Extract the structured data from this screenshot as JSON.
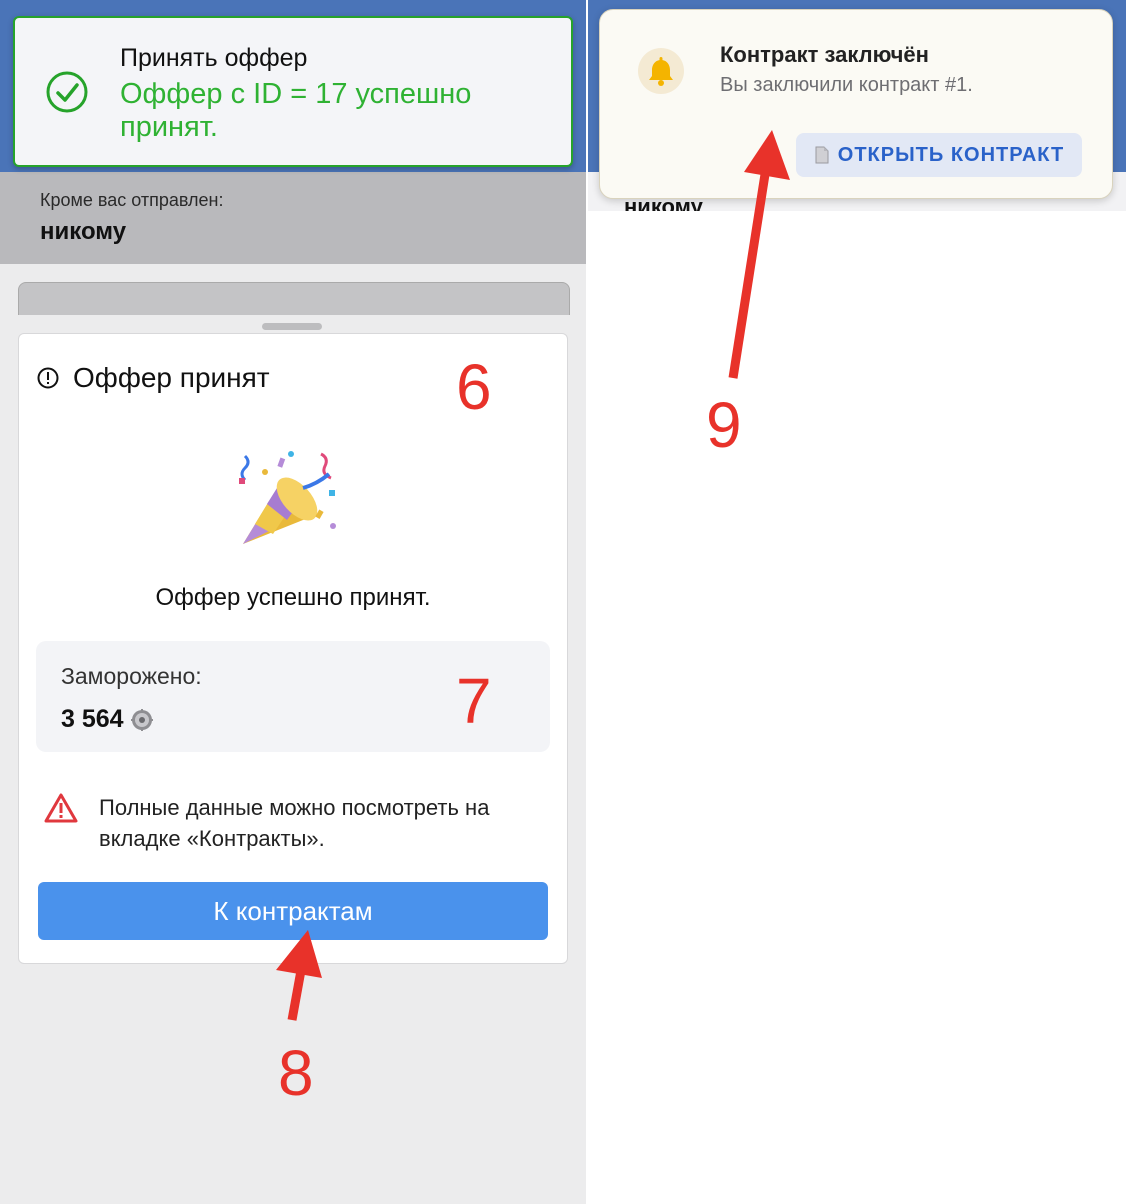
{
  "left_screen": {
    "toast": {
      "title": "Принять оффер",
      "message": "Оффер с ID = 17 успешно принят.",
      "icon": "check-circle-icon"
    },
    "sent_label": "Кроме вас отправлен:",
    "sent_value": "никому",
    "sheet": {
      "title": "Оффер принят",
      "title_icon": "exclamation-circle-icon",
      "illustration": "party-popper-icon",
      "success_text": "Оффер успешно принят.",
      "frozen_label": "Заморожено:",
      "frozen_value": "3 564",
      "currency_icon": "gear-coin-icon",
      "warning_text": "Полные данные можно посмотреть на вкладке «Контракты».",
      "warning_icon": "warning-triangle-icon",
      "button_label": "К контрактам"
    }
  },
  "right_screen": {
    "peek_text": "никому",
    "notification": {
      "icon": "bell-icon",
      "title": "Контракт заключён",
      "message": "Вы заключили контракт #1.",
      "button_label": "ОТКРЫТЬ КОНТРАКТ",
      "button_icon": "document-icon"
    }
  },
  "annotations": {
    "n6": "6",
    "n7": "7",
    "n8": "8",
    "n9": "9"
  },
  "colors": {
    "header_blue": "#4a74b8",
    "success_green": "#2fb233",
    "primary_button": "#4a92ec",
    "annotation_red": "#e8322a",
    "bell_yellow": "#f4b400"
  }
}
